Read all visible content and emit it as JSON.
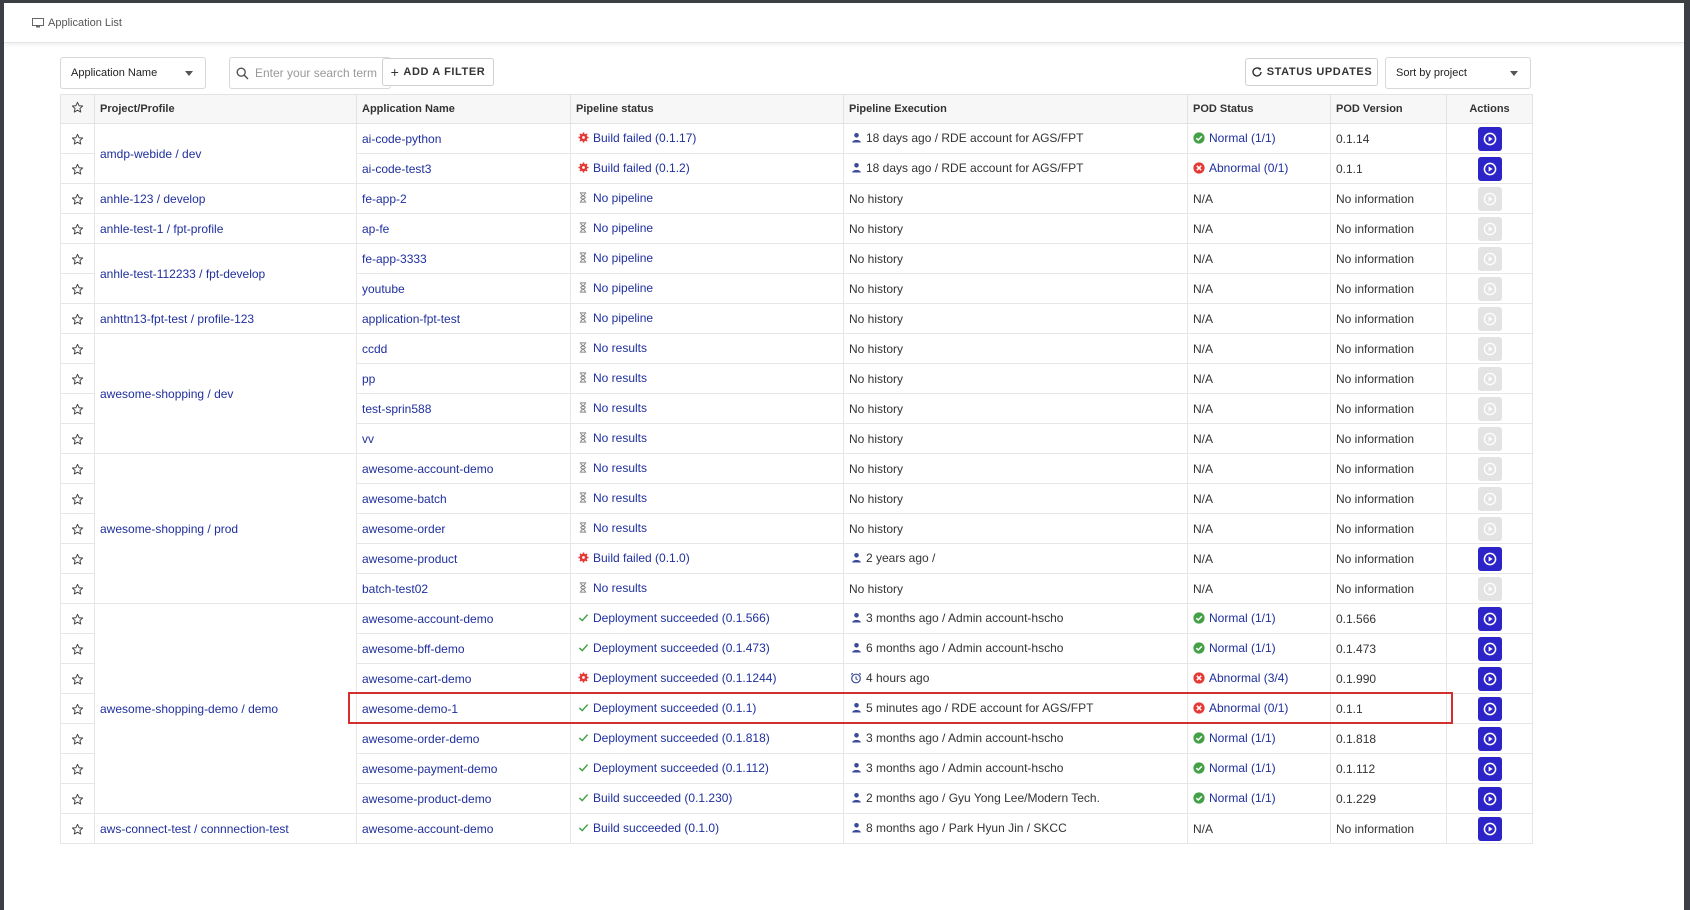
{
  "page": {
    "title": "Application List"
  },
  "toolbar": {
    "filter_field": "Application Name",
    "search_placeholder": "Enter your search term",
    "add_filter_label": "ADD A FILTER",
    "status_updates_label": "STATUS UPDATES",
    "sort_selected": "Sort by project"
  },
  "columns": [
    "Project/Profile",
    "Application Name",
    "Pipeline status",
    "Pipeline Execution",
    "POD Status",
    "POD Version",
    "Actions"
  ],
  "rows": [
    {
      "project": "amdp-webide / dev",
      "span": 2,
      "app": "ai-code-python",
      "pipeline_kind": "failed",
      "pipeline": "Build failed (0.1.17)",
      "exec_kind": "user",
      "exec": "18 days ago / RDE account for AGS/FPT",
      "pod_kind": "normal",
      "pod": "Normal (1/1)",
      "version": "0.1.14",
      "action": true
    },
    {
      "project": "",
      "span": 0,
      "app": "ai-code-test3",
      "pipeline_kind": "failed",
      "pipeline": "Build failed (0.1.2)",
      "exec_kind": "user",
      "exec": "18 days ago / RDE account for AGS/FPT",
      "pod_kind": "abnormal",
      "pod": "Abnormal (0/1)",
      "version": "0.1.1",
      "action": true
    },
    {
      "project": "anhle-123 / develop",
      "span": 1,
      "app": "fe-app-2",
      "pipeline_kind": "none",
      "pipeline": "No pipeline",
      "exec_kind": "text",
      "exec": "No history",
      "pod_kind": "na",
      "pod": "N/A",
      "version": "No information",
      "action": false
    },
    {
      "project": "anhle-test-1 / fpt-profile",
      "span": 1,
      "app": "ap-fe",
      "pipeline_kind": "none",
      "pipeline": "No pipeline",
      "exec_kind": "text",
      "exec": "No history",
      "pod_kind": "na",
      "pod": "N/A",
      "version": "No information",
      "action": false
    },
    {
      "project": "anhle-test-112233 / fpt-develop",
      "span": 2,
      "app": "fe-app-3333",
      "pipeline_kind": "none",
      "pipeline": "No pipeline",
      "exec_kind": "text",
      "exec": "No history",
      "pod_kind": "na",
      "pod": "N/A",
      "version": "No information",
      "action": false
    },
    {
      "project": "",
      "span": 0,
      "app": "youtube",
      "pipeline_kind": "none",
      "pipeline": "No pipeline",
      "exec_kind": "text",
      "exec": "No history",
      "pod_kind": "na",
      "pod": "N/A",
      "version": "No information",
      "action": false
    },
    {
      "project": "anhttn13-fpt-test / profile-123",
      "span": 1,
      "app": "application-fpt-test",
      "pipeline_kind": "none",
      "pipeline": "No pipeline",
      "exec_kind": "text",
      "exec": "No history",
      "pod_kind": "na",
      "pod": "N/A",
      "version": "No information",
      "action": false
    },
    {
      "project": "awesome-shopping / dev",
      "span": 4,
      "app": "ccdd",
      "pipeline_kind": "none",
      "pipeline": "No results",
      "exec_kind": "text",
      "exec": "No history",
      "pod_kind": "na",
      "pod": "N/A",
      "version": "No information",
      "action": false
    },
    {
      "project": "",
      "span": 0,
      "app": "pp",
      "pipeline_kind": "none",
      "pipeline": "No results",
      "exec_kind": "text",
      "exec": "No history",
      "pod_kind": "na",
      "pod": "N/A",
      "version": "No information",
      "action": false
    },
    {
      "project": "",
      "span": 0,
      "app": "test-sprin588",
      "pipeline_kind": "none",
      "pipeline": "No results",
      "exec_kind": "text",
      "exec": "No history",
      "pod_kind": "na",
      "pod": "N/A",
      "version": "No information",
      "action": false
    },
    {
      "project": "",
      "span": 0,
      "app": "vv",
      "pipeline_kind": "none",
      "pipeline": "No results",
      "exec_kind": "text",
      "exec": "No history",
      "pod_kind": "na",
      "pod": "N/A",
      "version": "No information",
      "action": false
    },
    {
      "project": "awesome-shopping / prod",
      "span": 5,
      "app": "awesome-account-demo",
      "pipeline_kind": "none",
      "pipeline": "No results",
      "exec_kind": "text",
      "exec": "No history",
      "pod_kind": "na",
      "pod": "N/A",
      "version": "No information",
      "action": false
    },
    {
      "project": "",
      "span": 0,
      "app": "awesome-batch",
      "pipeline_kind": "none",
      "pipeline": "No results",
      "exec_kind": "text",
      "exec": "No history",
      "pod_kind": "na",
      "pod": "N/A",
      "version": "No information",
      "action": false
    },
    {
      "project": "",
      "span": 0,
      "app": "awesome-order",
      "pipeline_kind": "none",
      "pipeline": "No results",
      "exec_kind": "text",
      "exec": "No history",
      "pod_kind": "na",
      "pod": "N/A",
      "version": "No information",
      "action": false
    },
    {
      "project": "",
      "span": 0,
      "app": "awesome-product",
      "pipeline_kind": "failed",
      "pipeline": "Build failed (0.1.0)",
      "exec_kind": "user",
      "exec": "2 years ago /",
      "pod_kind": "na",
      "pod": "N/A",
      "version": "No information",
      "action": true
    },
    {
      "project": "",
      "span": 0,
      "app": "batch-test02",
      "pipeline_kind": "none",
      "pipeline": "No results",
      "exec_kind": "text",
      "exec": "No history",
      "pod_kind": "na",
      "pod": "N/A",
      "version": "No information",
      "action": false
    },
    {
      "project": "awesome-shopping-demo / demo",
      "span": 7,
      "app": "awesome-account-demo",
      "pipeline_kind": "success",
      "pipeline": "Deployment succeeded (0.1.566)",
      "exec_kind": "user",
      "exec": "3 months ago / Admin account-hscho",
      "pod_kind": "normal",
      "pod": "Normal (1/1)",
      "version": "0.1.566",
      "action": true
    },
    {
      "project": "",
      "span": 0,
      "app": "awesome-bff-demo",
      "pipeline_kind": "success",
      "pipeline": "Deployment succeeded (0.1.473)",
      "exec_kind": "user",
      "exec": "6 months ago / Admin account-hscho",
      "pod_kind": "normal",
      "pod": "Normal (1/1)",
      "version": "0.1.473",
      "action": true
    },
    {
      "project": "",
      "span": 0,
      "app": "awesome-cart-demo",
      "pipeline_kind": "failed",
      "pipeline": "Deployment succeeded (0.1.1244)",
      "exec_kind": "clock",
      "exec": "4 hours ago",
      "pod_kind": "abnormal",
      "pod": "Abnormal (3/4)",
      "version": "0.1.990",
      "action": true
    },
    {
      "project": "",
      "span": 0,
      "app": "awesome-demo-1",
      "pipeline_kind": "success",
      "pipeline": "Deployment succeeded (0.1.1)",
      "exec_kind": "user",
      "exec": "5 minutes ago / RDE account for AGS/FPT",
      "pod_kind": "abnormal",
      "pod": "Abnormal (0/1)",
      "version": "0.1.1",
      "action": true
    },
    {
      "project": "",
      "span": 0,
      "app": "awesome-order-demo",
      "pipeline_kind": "success",
      "pipeline": "Deployment succeeded (0.1.818)",
      "exec_kind": "user",
      "exec": "3 months ago / Admin account-hscho",
      "pod_kind": "normal",
      "pod": "Normal (1/1)",
      "version": "0.1.818",
      "action": true
    },
    {
      "project": "",
      "span": 0,
      "app": "awesome-payment-demo",
      "pipeline_kind": "success",
      "pipeline": "Deployment succeeded (0.1.112)",
      "exec_kind": "user",
      "exec": "3 months ago / Admin account-hscho",
      "pod_kind": "normal",
      "pod": "Normal (1/1)",
      "version": "0.1.112",
      "action": true
    },
    {
      "project": "",
      "span": 0,
      "app": "awesome-product-demo",
      "pipeline_kind": "success",
      "pipeline": "Build succeeded (0.1.230)",
      "exec_kind": "user",
      "exec": "2 months ago / Gyu Yong Lee/Modern Tech.",
      "pod_kind": "normal",
      "pod": "Normal (1/1)",
      "version": "0.1.229",
      "action": true
    },
    {
      "project": "aws-connect-test / connnection-test",
      "span": 1,
      "app": "awesome-account-demo",
      "pipeline_kind": "success",
      "pipeline": "Build succeeded (0.1.0)",
      "exec_kind": "user",
      "exec": "8 months ago / Park Hyun Jin / SKCC",
      "pod_kind": "na",
      "pod": "N/A",
      "version": "No information",
      "action": true
    }
  ],
  "colors": {
    "link": "#1f2f9e",
    "failed": "#e53935",
    "success": "#43a047",
    "pending": "#888888",
    "abnormal": "#e53935",
    "normal": "#43a047",
    "action_active": "#2c23c9",
    "action_disabled": "#e3e3e3",
    "highlight": "#d32f2f"
  }
}
